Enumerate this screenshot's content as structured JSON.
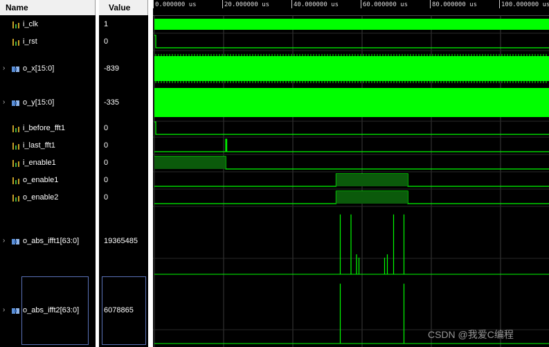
{
  "columns": {
    "name": "Name",
    "value": "Value"
  },
  "ruler": {
    "ticks": [
      "0.000000 us",
      "20.000000 us",
      "40.000000 us",
      "60.000000 us",
      "80.000000 us",
      "100.000000 us"
    ]
  },
  "signals": [
    {
      "id": "i_clk",
      "name": "i_clk",
      "value": "1",
      "type": "wire",
      "expandable": false
    },
    {
      "id": "i_rst",
      "name": "i_rst",
      "value": "0",
      "type": "wire",
      "expandable": false
    },
    {
      "id": "o_x",
      "name": "o_x[15:0]",
      "value": "-839",
      "type": "bus",
      "expandable": true
    },
    {
      "id": "o_y",
      "name": "o_y[15:0]",
      "value": "-335",
      "type": "bus",
      "expandable": true
    },
    {
      "id": "i_before_fft1",
      "name": "i_before_fft1",
      "value": "0",
      "type": "wire",
      "expandable": false
    },
    {
      "id": "i_last_fft1",
      "name": "i_last_fft1",
      "value": "0",
      "type": "wire",
      "expandable": false
    },
    {
      "id": "i_enable1",
      "name": "i_enable1",
      "value": "0",
      "type": "wire",
      "expandable": false
    },
    {
      "id": "o_enable1",
      "name": "o_enable1",
      "value": "0",
      "type": "wire",
      "expandable": false
    },
    {
      "id": "o_enable2",
      "name": "o_enable2",
      "value": "0",
      "type": "wire",
      "expandable": false
    },
    {
      "id": "o_abs_ifft1",
      "name": "o_abs_ifft1[63:0]",
      "value": "19365485",
      "type": "bus",
      "expandable": true
    },
    {
      "id": "o_abs_ifft2",
      "name": "o_abs_ifft2[63:0]",
      "value": "6078865",
      "type": "bus",
      "expandable": true
    }
  ],
  "waveforms": {
    "i_rst": [
      [
        0,
        1
      ],
      [
        0.4,
        0
      ]
    ],
    "i_before_fft1": [
      [
        0,
        1
      ],
      [
        0.4,
        0
      ]
    ],
    "i_last_fft1": [
      [
        0,
        0
      ],
      [
        20.6,
        1
      ],
      [
        20.9,
        0
      ]
    ],
    "i_enable1": [
      [
        0,
        1
      ],
      [
        20.6,
        0
      ]
    ],
    "o_enable1": [
      [
        0,
        0
      ],
      [
        52.5,
        1
      ],
      [
        73.2,
        0
      ]
    ],
    "o_enable2": [
      [
        0,
        0
      ],
      [
        52.5,
        1
      ],
      [
        73.2,
        0
      ]
    ],
    "o_abs_ifft1_spikes": [
      [
        53.7,
        0.9
      ],
      [
        56.8,
        0.9
      ],
      [
        58.4,
        0.3
      ],
      [
        59.1,
        0.25
      ],
      [
        66.5,
        0.25
      ],
      [
        67.3,
        0.3
      ],
      [
        69.1,
        0.9
      ],
      [
        72.1,
        0.9
      ]
    ],
    "o_abs_ifft2_spikes": [
      [
        53.7,
        0.9
      ],
      [
        72.1,
        0.9
      ]
    ]
  },
  "colors": {
    "wave": "#00ff00",
    "grid": "#3d3d3d",
    "header_bg": "#f0f0f0",
    "selection": "#5a72b8"
  },
  "watermark": "CSDN @我爱C编程"
}
